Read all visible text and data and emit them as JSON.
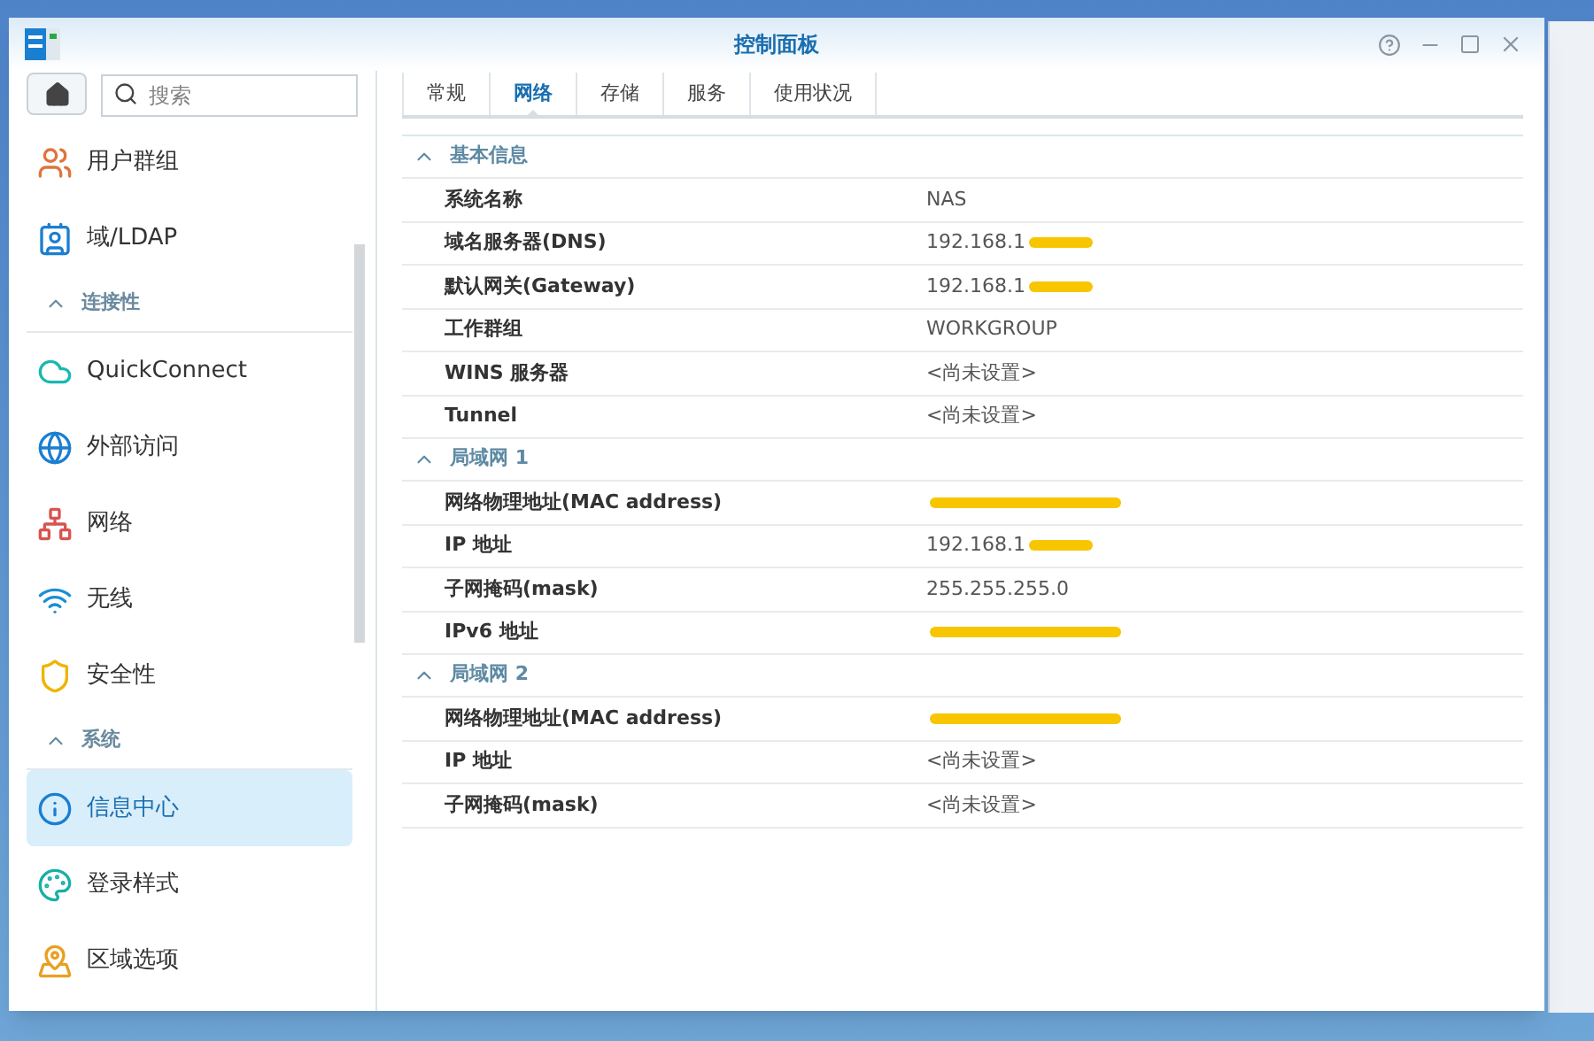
{
  "window": {
    "title": "控制面板"
  },
  "search": {
    "placeholder": "搜索"
  },
  "sidebar": {
    "items": [
      {
        "kind": "item",
        "label": "用户群组",
        "selected": false
      },
      {
        "kind": "item",
        "label": "域/LDAP",
        "selected": false
      },
      {
        "kind": "header",
        "label": "连接性"
      },
      {
        "kind": "item",
        "label": "QuickConnect",
        "selected": false
      },
      {
        "kind": "item",
        "label": "外部访问",
        "selected": false
      },
      {
        "kind": "item",
        "label": "网络",
        "selected": false
      },
      {
        "kind": "item",
        "label": "无线",
        "selected": false
      },
      {
        "kind": "item",
        "label": "安全性",
        "selected": false
      },
      {
        "kind": "header",
        "label": "系统"
      },
      {
        "kind": "item",
        "label": "信息中心",
        "selected": true
      },
      {
        "kind": "item",
        "label": "登录样式",
        "selected": false
      },
      {
        "kind": "item",
        "label": "区域选项",
        "selected": false
      }
    ]
  },
  "tabs": [
    {
      "label": "常规",
      "selected": false
    },
    {
      "label": "网络",
      "selected": true
    },
    {
      "label": "存储",
      "selected": false
    },
    {
      "label": "服务",
      "selected": false
    },
    {
      "label": "使用状况",
      "selected": false
    }
  ],
  "sections": [
    {
      "title": "基本信息",
      "expanded": true,
      "rows": [
        {
          "label": "系统名称",
          "value": "NAS",
          "redacted": false
        },
        {
          "label": "域名服务器(DNS)",
          "value": "192.168.1",
          "redacted": true
        },
        {
          "label": "默认网关(Gateway)",
          "value": "192.168.1",
          "redacted": true
        },
        {
          "label": "工作群组",
          "value": "WORKGROUP",
          "redacted": false
        },
        {
          "label": "WINS 服务器",
          "value": "<尚未设置>",
          "redacted": false
        },
        {
          "label": "Tunnel",
          "value": "<尚未设置>",
          "redacted": false
        }
      ]
    },
    {
      "title": "局域网 1",
      "expanded": true,
      "rows": [
        {
          "label": "网络物理地址(MAC address)",
          "redacted": true
        },
        {
          "label": "IP 地址",
          "value": "192.168.1",
          "redacted": true
        },
        {
          "label": "子网掩码(mask)",
          "value": "255.255.255.0",
          "redacted": false
        },
        {
          "label": "IPv6 地址",
          "redacted": true
        }
      ]
    },
    {
      "title": "局域网 2",
      "expanded": true,
      "rows": [
        {
          "label": "网络物理地址(MAC address)",
          "redacted": true
        },
        {
          "label": "IP 地址",
          "value": "<尚未设置>",
          "redacted": false
        },
        {
          "label": "子网掩码(mask)",
          "value": "<尚未设置>",
          "redacted": false
        }
      ]
    }
  ]
}
